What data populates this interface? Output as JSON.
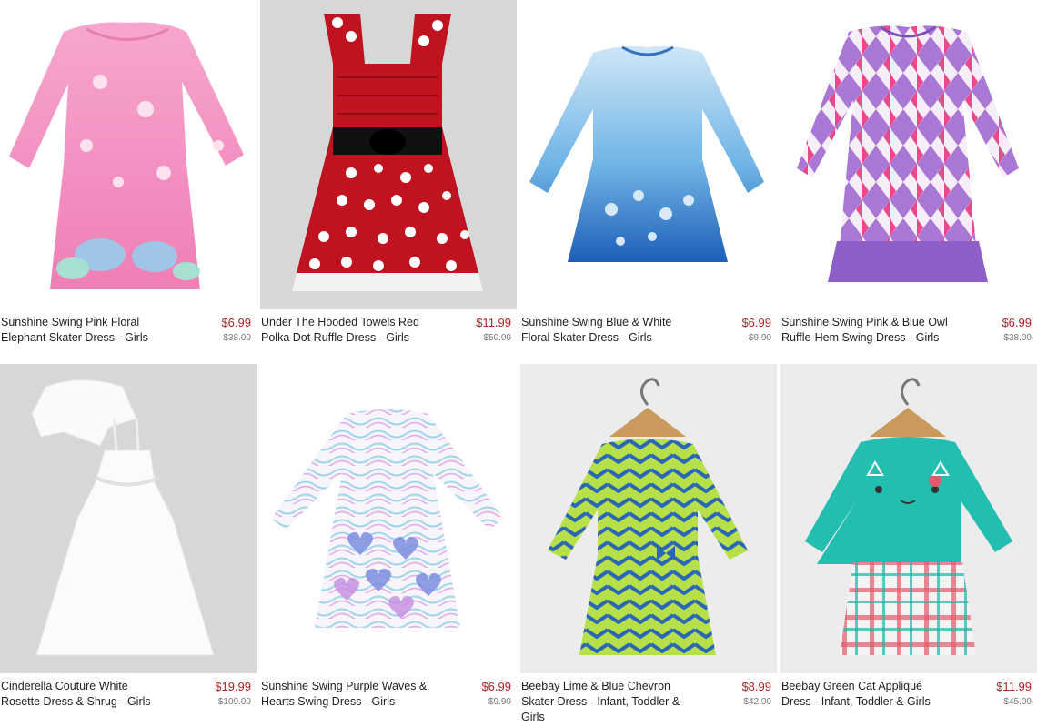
{
  "products": [
    {
      "name": "Sunshine Swing Pink Floral Elephant Skater Dress - Girls",
      "price": "$6.99",
      "original_price": "$38.00"
    },
    {
      "name": "Under The Hooded Towels Red Polka Dot Ruffle Dress - Girls",
      "price": "$11.99",
      "original_price": "$50.00"
    },
    {
      "name": "Sunshine Swing Blue & White Floral Skater Dress - Girls",
      "price": "$6.99",
      "original_price": "$9.90"
    },
    {
      "name": "Sunshine Swing Pink & Blue Owl Ruffle-Hem Swing Dress - Girls",
      "price": "$6.99",
      "original_price": "$38.00"
    },
    {
      "name": "Cinderella Couture White Rosette Dress & Shrug - Girls",
      "price": "$19.99",
      "original_price": "$100.00"
    },
    {
      "name": "Sunshine Swing Purple Waves & Hearts Swing Dress - Girls",
      "price": "$6.99",
      "original_price": "$9.90"
    },
    {
      "name": "Beebay Lime & Blue Chevron Skater Dress - Infant, Toddler & Girls",
      "price": "$8.99",
      "original_price": "$42.00"
    },
    {
      "name": "Beebay Green Cat Appliqué Dress - Infant, Toddler & Girls",
      "price": "$11.99",
      "original_price": "$45.00"
    }
  ],
  "colors": {
    "sale_price": "#b22222",
    "original_price": "#777777",
    "title": "#222222"
  }
}
